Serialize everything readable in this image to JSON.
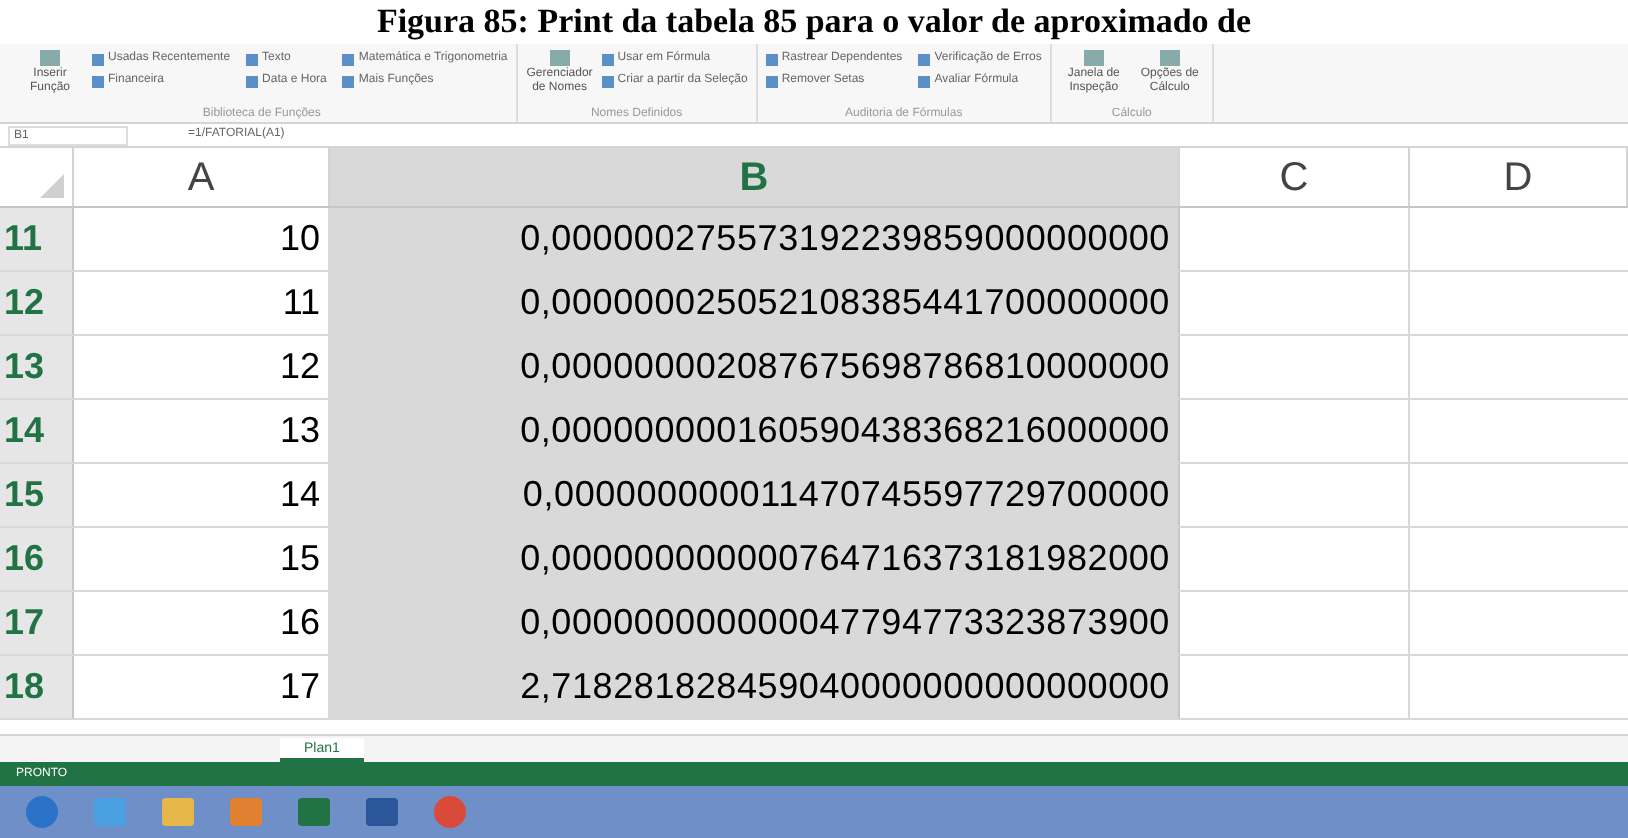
{
  "caption": "Figura 85: Print da tabela 85 para o valor de aproximado de",
  "ribbon": {
    "groups": [
      {
        "label": "Biblioteca de Funções",
        "buttons": [
          {
            "text": "Inserir Função",
            "kind": "big"
          },
          {
            "text": "Usadas Recentemente",
            "kind": "small"
          },
          {
            "text": "Financeira",
            "kind": "small"
          },
          {
            "text": "Texto",
            "kind": "small"
          },
          {
            "text": "Data e Hora",
            "kind": "small"
          },
          {
            "text": "Matemática e Trigonometria",
            "kind": "small"
          },
          {
            "text": "Mais Funções",
            "kind": "small"
          }
        ]
      },
      {
        "label": "Nomes Definidos",
        "buttons": [
          {
            "text": "Gerenciador de Nomes",
            "kind": "big"
          },
          {
            "text": "Usar em Fórmula",
            "kind": "small"
          },
          {
            "text": "Criar a partir da Seleção",
            "kind": "small"
          }
        ]
      },
      {
        "label": "Auditoria de Fórmulas",
        "buttons": [
          {
            "text": "Rastrear Dependentes",
            "kind": "small"
          },
          {
            "text": "Remover Setas",
            "kind": "small"
          },
          {
            "text": "Verificação de Erros",
            "kind": "small"
          },
          {
            "text": "Avaliar Fórmula",
            "kind": "small"
          }
        ]
      },
      {
        "label": "Cálculo",
        "buttons": [
          {
            "text": "Janela de Inspeção",
            "kind": "big"
          },
          {
            "text": "Opções de Cálculo",
            "kind": "big"
          }
        ]
      }
    ]
  },
  "name_box": "B1",
  "formula": "=1/FATORIAL(A1)",
  "columns": [
    {
      "label": "A",
      "selected": false
    },
    {
      "label": "B",
      "selected": true
    },
    {
      "label": "C",
      "selected": false
    },
    {
      "label": "D",
      "selected": false
    }
  ],
  "rows": [
    {
      "header": "11",
      "a": "10",
      "b": "0,000000275573192239859000000000"
    },
    {
      "header": "12",
      "a": "11",
      "b": "0,000000025052108385441700000000"
    },
    {
      "header": "13",
      "a": "12",
      "b": "0,000000002087675698786810000000"
    },
    {
      "header": "14",
      "a": "13",
      "b": "0,000000000160590438368216000000"
    },
    {
      "header": "15",
      "a": "14",
      "b": "0,000000000011470745597729700000"
    },
    {
      "header": "16",
      "a": "15",
      "b": "0,000000000000764716373181982000"
    },
    {
      "header": "17",
      "a": "16",
      "b": "0,000000000000047794773323873900"
    },
    {
      "header": "18",
      "a": "17",
      "b": "2,718281828459040000000000000000"
    }
  ],
  "sheet_tabs": [
    {
      "label": "Plan1",
      "selected": true
    }
  ],
  "status": "PRONTO"
}
